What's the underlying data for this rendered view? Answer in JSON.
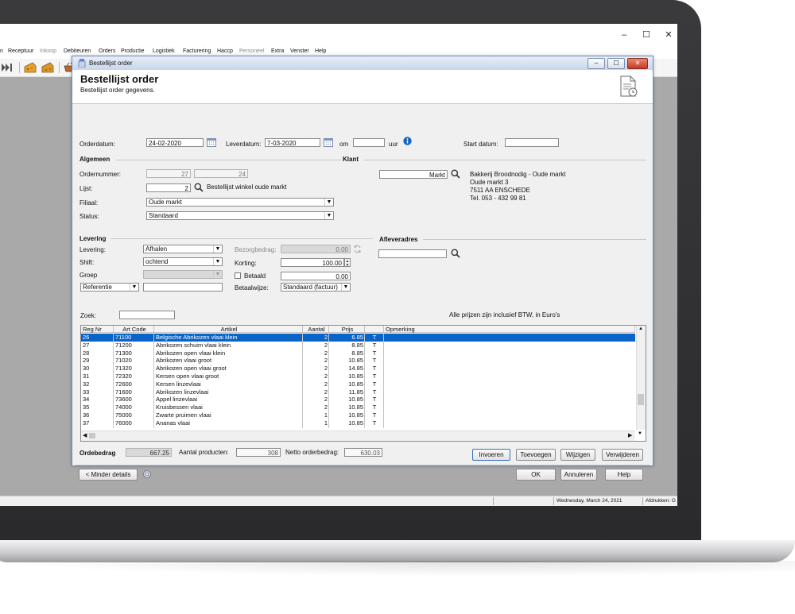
{
  "menu": [
    "n",
    "Receptuur",
    "Inkoop",
    "Debiteuren",
    "Orders",
    "Productie",
    "Logistiek",
    "Facturering",
    "Haccp",
    "Personeel",
    "Extra",
    "Venster",
    "Help"
  ],
  "window_controls": {
    "minimize": "–",
    "maximize": "☐",
    "close": "✕"
  },
  "dialog": {
    "title": "Bestellijst order",
    "heading": "Bestellijst order",
    "subheading": "Bestellijst order gegevens.",
    "controls": {
      "minimize": "–",
      "maximize": "☐",
      "close": "✕"
    }
  },
  "dates": {
    "orderdatum_label": "Orderdatum:",
    "orderdatum_value": "24-02-2020",
    "leverdatum_label": "Leverdatum:",
    "leverdatum_value": "7-03-2020",
    "om_label": "om",
    "om_value": "",
    "uur_label": "uur",
    "startdatum_label": "Start datum:",
    "startdatum_value": ""
  },
  "algemeen": {
    "section_label": "Algemeen",
    "ordernummer_label": "Ordernummer:",
    "ordernummer_1": "27",
    "ordernummer_2": "24",
    "lijst_label": "Lijst:",
    "lijst_value": "2",
    "lijst_name": "Bestellijst winkel oude markt",
    "filiaal_label": "Filiaal:",
    "filiaal_value": "Oude markt",
    "status_label": "Status:",
    "status_value": "Standaard"
  },
  "klant": {
    "section_label": "Klant",
    "search_value": "Markt",
    "address": [
      "Bakkerij Broodnodig - Oude markt",
      "Oude markt 3",
      "7511 AA  ENSCHEDE",
      "Tel. 053 - 432 99 81"
    ]
  },
  "levering": {
    "section_label": "Levering",
    "levering_label": "Levering:",
    "levering_value": "Afhalen",
    "shift_label": "Shift:",
    "shift_value": "ochtend",
    "groep_label": "Groep",
    "groep_value": "",
    "referentie_value": "Referentie",
    "referentie_text": "",
    "bezorgbedrag_label": "Bezorgbedrag:",
    "bezorgbedrag_value": "0.00",
    "korting_label": "Korting:",
    "korting_value": "100.00",
    "betaald_label": "Betaald",
    "betaald_value": "0.00",
    "betaalwijze_label": "Betaalwijze:",
    "betaalwijze_value": "Standaard (factuur)"
  },
  "afleveradres": {
    "section_label": "Afleveradres",
    "value": ""
  },
  "search": {
    "label": "Zoek:",
    "value": "",
    "price_note": "Alle prijzen zijn inclusief BTW, in Euro's"
  },
  "table": {
    "columns": [
      "Reg Nr",
      "Art Code",
      "Artikel",
      "Aantal",
      "Prijs",
      "",
      "Opmerking"
    ],
    "rows": [
      [
        "26",
        "71100",
        "Belgische Abrikozen vlaai klein",
        "2",
        "6.85",
        "T",
        ""
      ],
      [
        "27",
        "71200",
        "Abrikozen schuim vlaai klein",
        "2",
        "8.85",
        "T",
        ""
      ],
      [
        "28",
        "71300",
        "Abrikozen open vlaai klein",
        "2",
        "8.85",
        "T",
        ""
      ],
      [
        "29",
        "71020",
        "Abrikozen vlaai groot",
        "2",
        "10.85",
        "T",
        ""
      ],
      [
        "30",
        "71320",
        "Abrikozen open vlaai groot",
        "2",
        "14.85",
        "T",
        ""
      ],
      [
        "31",
        "72320",
        "Kersen open vlaai groot",
        "2",
        "10.85",
        "T",
        ""
      ],
      [
        "32",
        "72600",
        "Kersen linzevlaai",
        "2",
        "10.85",
        "T",
        ""
      ],
      [
        "33",
        "71600",
        "Abrikozen linzevlaai",
        "2",
        "11.85",
        "T",
        ""
      ],
      [
        "34",
        "73600",
        "Appel linzevlaai",
        "2",
        "10.85",
        "T",
        ""
      ],
      [
        "35",
        "74000",
        "Kruisbessen vlaai",
        "2",
        "10.85",
        "T",
        ""
      ],
      [
        "36",
        "75000",
        "Zwarte pruimen vlaai",
        "1",
        "10.85",
        "T",
        ""
      ],
      [
        "37",
        "76000",
        "Ananas vlaai",
        "1",
        "10.85",
        "T",
        ""
      ]
    ],
    "selected_row": 0
  },
  "totals": {
    "orderbedrag_label": "Ordebedrag",
    "orderbedrag_value": "667.25",
    "aantal_label": "Aantal producten:",
    "aantal_value": "308",
    "netto_label": "Netto orderbedrag:",
    "netto_value": "630.03"
  },
  "buttons": {
    "invoeren": "Invoeren",
    "toevoegen": "Toevoegen",
    "wijzigen": "Wijzigen",
    "verwijderen": "Verwijderen",
    "minder_details": "< Minder details",
    "ok": "OK",
    "annuleren": "Annuleren",
    "help": "Help"
  },
  "statusbar": {
    "date": "Wednesday, March 24, 2021",
    "afdrukken": "Afdrukken: G"
  },
  "colors": {
    "selection": "#0a63c9",
    "dialog_bg": "#f0f0f0",
    "desktop": "#a9a9a9",
    "info_icon": "#1565c0"
  }
}
